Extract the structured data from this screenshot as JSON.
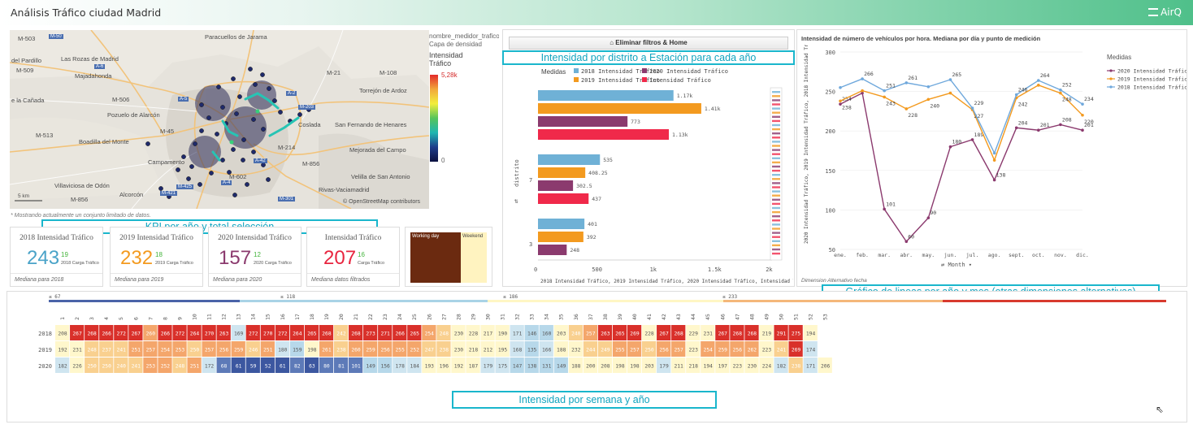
{
  "header": {
    "title": "Análisis Tráfico ciudad Madrid",
    "brand": "AirQ"
  },
  "map": {
    "legend_field": "nombre_medidor_trafico",
    "legend_layer": "Capa de densidad",
    "legend_measure": "Intensidad Tráfico",
    "legend_max": "5,28k",
    "legend_min": "0",
    "scale": "5 km",
    "attribution": "© OpenStreetMap contributors",
    "note": "* Mostrando actualmente un conjunto limitado de datos.",
    "places": [
      "Paracuellos de Jarama",
      "del Pardillo",
      "Las Rozas de Madrid",
      "Majadahonda",
      "Torrejón de Ardoz",
      "e la Cañada",
      "Pozuelo de Alarcón",
      "Coslada",
      "San Fernando de Henares",
      "Boadilla del Monte",
      "Mejorada del Campo",
      "Campamento",
      "Villaviciosa de Odón",
      "Alcorcón",
      "Velilla de San Antonio",
      "Rivas-Vaciamadrid",
      "Móstoles"
    ],
    "roads": [
      "M-503",
      "M-50",
      "M-509",
      "M-513",
      "M-500",
      "M-40",
      "M-511",
      "M-506",
      "M-45",
      "M-30",
      "M-11",
      "M-111",
      "M-100",
      "M-115",
      "M-108",
      "M-21",
      "M-201",
      "M-206",
      "M-214",
      "M-203",
      "M-602",
      "M-856",
      "M-421",
      "M-425",
      "M-406",
      "A-6",
      "A-5",
      "A-4",
      "A-2",
      "A-3",
      "A-42",
      "R-3",
      "M-31",
      "M-301",
      "M-607",
      "M-12",
      "M-603",
      "M-506"
    ]
  },
  "filters": {
    "clear_button": "Eliminar filtros & Home"
  },
  "callouts": {
    "bar": "Intensidad por distrito a Estación para cada año",
    "kpi": "KPI por año y total selección",
    "line": "Gráfico de lineas por año y mes (otras dimensiones alternativas)",
    "heat": "Intensidad por semana y año"
  },
  "kpis": [
    {
      "title": "2018 Intensidad Tráfico",
      "big": "243",
      "small": "19",
      "label": "2018 Carga Tráfico",
      "foot": "Mediana para 2018",
      "color": "#4aa3c8"
    },
    {
      "title": "2019 Intensidad Tráfico",
      "big": "232",
      "small": "18",
      "label": "2019 Carga Tráfico",
      "foot": "Mediana para 2019",
      "color": "#f39a1f"
    },
    {
      "title": "2020 Intensidad Tráfico",
      "big": "157",
      "small": "12",
      "label": "2020 Carga Tráfico",
      "foot": "Mediana para 2020",
      "color": "#8b3a6e"
    },
    {
      "title": "Intensidad Tráfico",
      "big": "207",
      "small": "16",
      "label": "Carga Tráfico",
      "foot": "Mediana datos filtrados",
      "color": "#e8253f"
    }
  ],
  "daytype": {
    "working": "Working day",
    "weekend": "Weekend",
    "working_color": "#6b2a10",
    "weekend_color": "#fff3c0"
  },
  "bar_chart": {
    "legend_title": "Medidas",
    "series": [
      {
        "name": "2018 Intensidad Tráfico",
        "color": "#6fb1d6"
      },
      {
        "name": "2020 Intensidad Tráfico",
        "color": "#8b3a6e"
      },
      {
        "name": "2019 Intensidad Tráfico",
        "color": "#f39a1f"
      },
      {
        "name": "Intensidad Tráfico",
        "color": "#f0294a"
      }
    ],
    "dim_label": "distrito",
    "xlabel": "2018 Intensidad Tráfico, 2019 Intensidad Tráfico, 2020 Intensidad Tráfico, Intensidad Tráfico",
    "xticks": [
      "0",
      "500",
      "1k",
      "1.5k",
      "2k"
    ]
  },
  "line_chart": {
    "title": "Intensidad de número de vehículos por hora. Mediana por día y punto de medición",
    "ylabel": "2020 Intensidad Tráfico, 2019 Intensidad Tráfico, 2018 Intensidad Tráfico",
    "legend_title": "Medidas",
    "dim_label": "Month",
    "footer": "Dimension Alternativo fecha"
  },
  "heatmap": {
    "range_labels": [
      "≤ 67",
      "≤ 118",
      "≤ 186",
      "≤ 233"
    ],
    "years": [
      "2018",
      "2019",
      "2020"
    ],
    "weeks": [
      "1",
      "2",
      "3",
      "4",
      "5",
      "6",
      "7",
      "8",
      "9",
      "10",
      "11",
      "12",
      "13",
      "14",
      "15",
      "16",
      "17",
      "18",
      "19",
      "20",
      "21",
      "22",
      "23",
      "24",
      "25",
      "26",
      "27",
      "28",
      "29",
      "30",
      "31",
      "32",
      "33",
      "34",
      "35",
      "36",
      "37",
      "38",
      "39",
      "40",
      "41",
      "42",
      "43",
      "44",
      "45",
      "46",
      "47",
      "48",
      "49",
      "50",
      "51",
      "52",
      "53"
    ],
    "rows": [
      [
        "208",
        "267",
        "268",
        "266",
        "272",
        "267",
        "260",
        "266",
        "272",
        "264",
        "270",
        "263",
        "169",
        "272",
        "270",
        "272",
        "264",
        "265",
        "268",
        "242",
        "268",
        "273",
        "271",
        "266",
        "265",
        "254",
        "248",
        "230",
        "228",
        "217",
        "190",
        "171",
        "146",
        "160",
        "203",
        "240",
        "257",
        "263",
        "265",
        "269",
        "228",
        "267",
        "268",
        "229",
        "231",
        "267",
        "268",
        "268",
        "219",
        "291",
        "275",
        "194",
        ""
      ],
      [
        "192",
        "231",
        "248",
        "237",
        "241",
        "251",
        "257",
        "254",
        "253",
        "250",
        "257",
        "256",
        "259",
        "246",
        "251",
        "180",
        "159",
        "198",
        "261",
        "238",
        "260",
        "259",
        "256",
        "255",
        "252",
        "247",
        "238",
        "230",
        "218",
        "212",
        "195",
        "168",
        "135",
        "166",
        "188",
        "232",
        "244",
        "249",
        "255",
        "257",
        "250",
        "256",
        "257",
        "223",
        "254",
        "259",
        "256",
        "262",
        "223",
        "241",
        "269",
        "174",
        ""
      ],
      [
        "182",
        "226",
        "250",
        "250",
        "240",
        "241",
        "253",
        "252",
        "248",
        "251",
        "172",
        "68",
        "61",
        "59",
        "52",
        "61",
        "82",
        "63",
        "80",
        "81",
        "101",
        "149",
        "156",
        "178",
        "184",
        "193",
        "196",
        "192",
        "187",
        "179",
        "175",
        "147",
        "138",
        "131",
        "149",
        "188",
        "200",
        "208",
        "198",
        "198",
        "203",
        "179",
        "211",
        "218",
        "194",
        "197",
        "223",
        "230",
        "224",
        "182",
        "238",
        "171",
        "206"
      ]
    ]
  },
  "chart_data": [
    {
      "type": "bar",
      "title": "Intensidad por distrito a Estación para cada año",
      "xlabel": "2018 Intensidad Tráfico, 2019 Intensidad Tráfico, 2020 Intensidad Tráfico, Intensidad Tráfico",
      "ylabel": "distrito",
      "categories": [
        "",
        "7",
        "3"
      ],
      "xlim": [
        0,
        2000
      ],
      "series": [
        {
          "name": "2018 Intensidad Tráfico",
          "values": [
            1170,
            535,
            401
          ]
        },
        {
          "name": "2019 Intensidad Tráfico",
          "values": [
            1410,
            408.25,
            392
          ]
        },
        {
          "name": "2020 Intensidad Tráfico",
          "values": [
            773,
            302.5,
            248
          ]
        },
        {
          "name": "Intensidad Tráfico",
          "values": [
            1130,
            437,
            null
          ]
        }
      ],
      "data_labels": [
        [
          "1.17k",
          "1.41k",
          "773",
          "1.13k"
        ],
        [
          "535",
          "408.25",
          "302.5",
          "437"
        ],
        [
          "401",
          "392",
          "248",
          ""
        ]
      ]
    },
    {
      "type": "line",
      "title": "Intensidad de número de vehículos por hora. Mediana por día y punto de medición",
      "xlabel": "Month",
      "ylabel": "2020 Intensidad Tráfico, 2019 Intensidad Tráfico, 2018 Intensidad Tráfico",
      "categories": [
        "ene.",
        "feb.",
        "mar.",
        "abr.",
        "may.",
        "jun.",
        "jul.",
        "ago.",
        "sept.",
        "oct.",
        "nov.",
        "dic."
      ],
      "ylim": [
        50,
        300
      ],
      "yticks": [
        50,
        100,
        150,
        200,
        250,
        300
      ],
      "series": [
        {
          "name": "2020 Intensidad Tráfico",
          "color": "#8b3a6e",
          "values": [
            234,
            248,
            101,
            60,
            90,
            180,
            189,
            138,
            204,
            201,
            208,
            201
          ]
        },
        {
          "name": "2019 Intensidad Tráfico",
          "color": "#f39a1f",
          "values": [
            238,
            251,
            243,
            228,
            240,
            248,
            227,
            163,
            242,
            258,
            248,
            220
          ]
        },
        {
          "name": "2018 Intensidad Tráfico",
          "color": "#6fa8dc",
          "values": [
            255,
            266,
            251,
            261,
            256,
            265,
            229,
            172,
            246,
            264,
            252,
            234
          ]
        }
      ],
      "labels": {
        "2020": [
          "234",
          "",
          "101",
          "60",
          "90",
          "180",
          "189",
          "138",
          "204",
          "201",
          "208",
          "201"
        ],
        "2019": [
          "238",
          "",
          "243",
          "228",
          "240",
          "",
          "227",
          "",
          "242",
          "",
          "248",
          "220"
        ],
        "2018": [
          "",
          "266",
          "251",
          "261",
          "",
          "265",
          "229",
          "",
          "246",
          "264",
          "252",
          "234"
        ]
      }
    }
  ]
}
